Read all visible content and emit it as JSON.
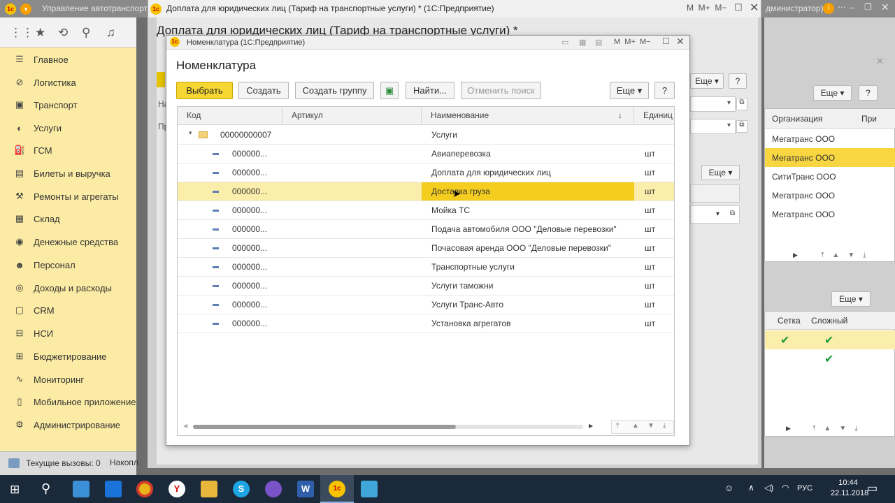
{
  "app": {
    "main_title": "Управление автотранспорт...",
    "doc_window_title": "Доплата для юридических лиц (Тариф на транспортные услуги) *  (1С:Предприятие)",
    "user_fragment": "дминистратор)",
    "doc_heading": "Доплата для юридических лиц (Тариф на транспортные услуги) *"
  },
  "sidebar": {
    "items": [
      {
        "label": "Главное",
        "icon": "menu-icon"
      },
      {
        "label": "Логистика",
        "icon": "logistics-icon"
      },
      {
        "label": "Транспорт",
        "icon": "transport-icon"
      },
      {
        "label": "Услуги",
        "icon": "services-icon"
      },
      {
        "label": "ГСМ",
        "icon": "fuel-icon"
      },
      {
        "label": "Билеты и выручка",
        "icon": "tickets-icon"
      },
      {
        "label": "Ремонты и агрегаты",
        "icon": "repairs-icon"
      },
      {
        "label": "Склад",
        "icon": "warehouse-icon"
      },
      {
        "label": "Денежные средства",
        "icon": "money-icon"
      },
      {
        "label": "Персонал",
        "icon": "staff-icon"
      },
      {
        "label": "Доходы и расходы",
        "icon": "income-icon"
      },
      {
        "label": "CRM",
        "icon": "crm-icon"
      },
      {
        "label": "НСИ",
        "icon": "reference-icon"
      },
      {
        "label": "Бюджетирование",
        "icon": "budget-icon"
      },
      {
        "label": "Мониторинг",
        "icon": "monitoring-icon"
      },
      {
        "label": "Мобильное приложение",
        "icon": "mobile-icon"
      },
      {
        "label": "Администрирование",
        "icon": "gear-icon"
      }
    ]
  },
  "statusbar": {
    "calls": "Текущие вызовы: 0",
    "accum": "Накопл"
  },
  "modal": {
    "window_title": "Номенклатура  (1С:Предприятие)",
    "heading": "Номенклатура",
    "buttons": {
      "select": "Выбрать",
      "create": "Создать",
      "create_group": "Создать группу",
      "find": "Найти...",
      "cancel_search": "Отменить поиск",
      "more": "Еще",
      "help": "?"
    },
    "columns": {
      "code": "Код",
      "article": "Артикул",
      "name": "Наименование",
      "unit": "Единиц"
    },
    "group_row": {
      "code": "00000000007",
      "name": "Услуги"
    },
    "rows": [
      {
        "code": "000000...",
        "name": "Авиаперевозка",
        "unit": "шт"
      },
      {
        "code": "000000...",
        "name": "Доплата для юридических лиц",
        "unit": "шт"
      },
      {
        "code": "000000...",
        "name": "Доставка груза",
        "unit": "шт"
      },
      {
        "code": "000000...",
        "name": "Мойка ТС",
        "unit": "шт"
      },
      {
        "code": "000000...",
        "name": "Подача автомобиля ООО \"Деловые перевозки\"",
        "unit": "шт"
      },
      {
        "code": "000000...",
        "name": "Почасовая аренда ООО \"Деловые перевозки\"",
        "unit": "шт"
      },
      {
        "code": "000000...",
        "name": "Транспортные услуги",
        "unit": "шт"
      },
      {
        "code": "000000...",
        "name": "Услуги таможни",
        "unit": "шт"
      },
      {
        "code": "000000...",
        "name": "Услуги Транс-Авто",
        "unit": "шт"
      },
      {
        "code": "000000...",
        "name": "Установка агрегатов",
        "unit": "шт"
      }
    ]
  },
  "right_panel": {
    "org_header": "Организация",
    "extra_header": "При",
    "orgs": [
      "Мегатранс ООО",
      "Мегатранс ООО",
      "СитиТранс ООО",
      "Мегатранс ООО",
      "Мегатранс ООО"
    ],
    "more": "Еще",
    "grid_header": "Сетка",
    "complex_header": "Сложный"
  },
  "taskbar": {
    "lang": "РУС",
    "time": "10:44",
    "date": "22.11.2018"
  }
}
